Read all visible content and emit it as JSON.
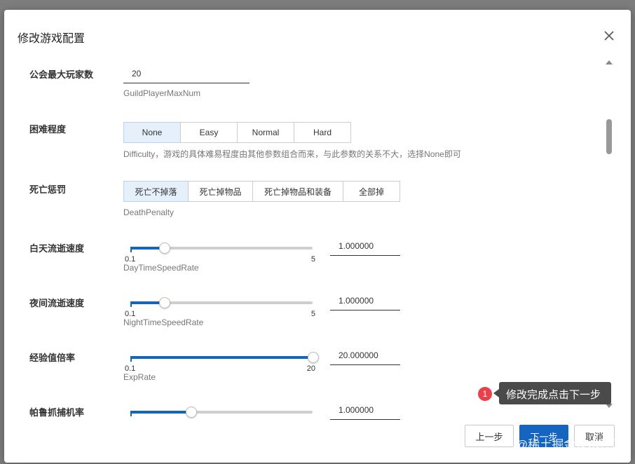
{
  "dialog": {
    "title": "修改游戏配置"
  },
  "fields": {
    "guild": {
      "label": "公会最大玩家数",
      "value": "20",
      "help": "GuildPlayerMaxNum"
    },
    "difficulty": {
      "label": "困难程度",
      "options": [
        "None",
        "Easy",
        "Normal",
        "Hard"
      ],
      "selected": "None",
      "help": "Difficulty，游戏的具体难易程度由其他参数组合而来，与此参数的关系不大，选择None即可"
    },
    "death": {
      "label": "死亡惩罚",
      "options": [
        "死亡不掉落",
        "死亡掉物品",
        "死亡掉物品和装备",
        "全部掉"
      ],
      "selected": "死亡不掉落",
      "help": "DeathPenalty"
    },
    "day": {
      "label": "白天流逝速度",
      "min": "0.1",
      "max": "5",
      "value": "1.000000",
      "fraction": 0.184,
      "help": "DayTimeSpeedRate"
    },
    "night": {
      "label": "夜间流逝速度",
      "min": "0.1",
      "max": "5",
      "value": "1.000000",
      "fraction": 0.184,
      "help": "NightTimeSpeedRate"
    },
    "exp": {
      "label": "经验值倍率",
      "min": "0.1",
      "max": "20",
      "value": "20.000000",
      "fraction": 1.0,
      "help": "ExpRate"
    },
    "pal": {
      "label": "帕鲁抓捕机率",
      "value": "1.000000",
      "fraction": 0.33
    }
  },
  "tooltip": {
    "badge": "1",
    "text": "修改完成点击下一步"
  },
  "buttons": {
    "prev": "上一步",
    "next": "下一步",
    "cancel": "取消"
  },
  "watermark": "@稀土掘金技术社区",
  "colors": {
    "primary": "#1565c0",
    "badge": "#e8414b",
    "tooltip_bg": "#4a4a4a"
  }
}
